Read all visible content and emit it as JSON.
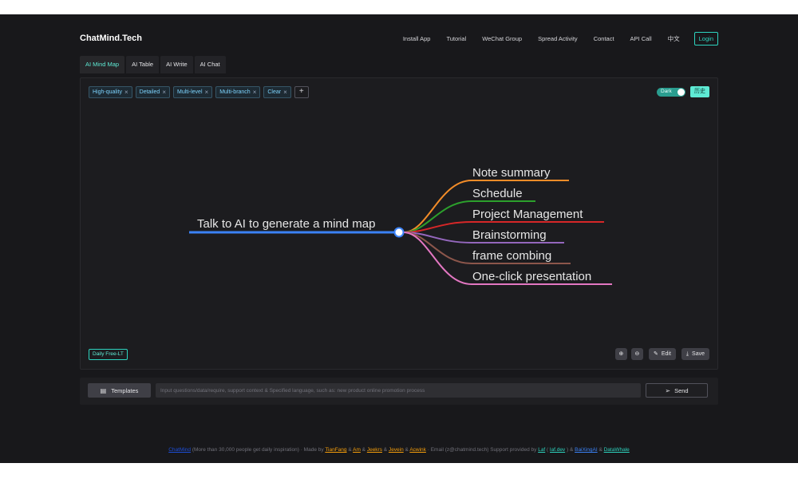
{
  "brand": "ChatMind.Tech",
  "nav": [
    {
      "label": "Install App",
      "name": "nav-install-app"
    },
    {
      "label": "Tutorial",
      "name": "nav-tutorial"
    },
    {
      "label": "WeChat Group",
      "name": "nav-wechat-group"
    },
    {
      "label": "Spread Activity",
      "name": "nav-spread-activity"
    },
    {
      "label": "Contact",
      "name": "nav-contact"
    },
    {
      "label": "API Call",
      "name": "nav-api-call"
    },
    {
      "label": "中文",
      "name": "nav-language"
    }
  ],
  "login_label": "Login",
  "tabs": [
    {
      "label": "AI Mind Map",
      "active": true
    },
    {
      "label": "AI Table",
      "active": false
    },
    {
      "label": "AI Write",
      "active": false
    },
    {
      "label": "AI Chat",
      "active": false
    }
  ],
  "tags": [
    "High-quality",
    "Detailed",
    "Multi-level",
    "Multi-branch",
    "Clear"
  ],
  "tag_add": "+",
  "dark_label": "Dark",
  "history_label": "历史",
  "mindmap": {
    "root": "Talk to AI to generate a mind map",
    "root_color": "#3b82f6",
    "branches": [
      {
        "label": "Note summary",
        "color": "#f28c28"
      },
      {
        "label": "Schedule",
        "color": "#2ca02c"
      },
      {
        "label": "Project Management",
        "color": "#d62728"
      },
      {
        "label": "Brainstorming",
        "color": "#9467bd"
      },
      {
        "label": "frame combing",
        "color": "#8c564b"
      },
      {
        "label": "One-click presentation",
        "color": "#e377c2"
      }
    ]
  },
  "daily_label": "Daily Free-LT",
  "tools": {
    "zoom_in_icon": "zoom-in-icon",
    "zoom_out_icon": "zoom-out-icon",
    "edit_label": "Edit",
    "save_label": "Save"
  },
  "input": {
    "templates_label": "Templates",
    "placeholder": "Input questions/data/require, support context & Specified language, such as: new product online promotion process",
    "send_label": "Send"
  },
  "footer": {
    "brand": "ChatMind",
    "text1": " (More than 30,000 people get daily inspiration) · Made by ",
    "authors": [
      "TianFang",
      "Am",
      "Jeekrs",
      "Jevein",
      "Acwink"
    ],
    "email": " · Email (z@chatmind.tech)    Support provided by ",
    "laf": "Laf",
    "laf_dev": "laf.dev",
    "baixing": "BaiXingAI",
    "datawhale": "DataWhale"
  }
}
